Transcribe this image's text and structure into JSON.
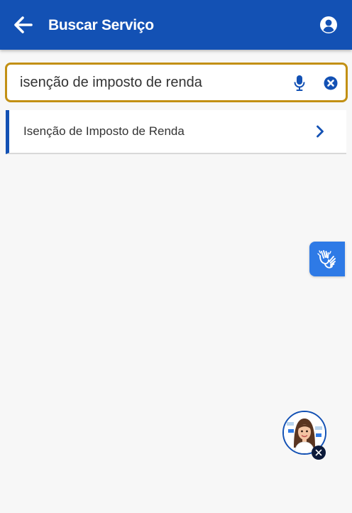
{
  "header": {
    "title": "Buscar Serviço",
    "back_icon": "arrow-left-icon",
    "account_icon": "user-circle-icon",
    "background_color": "#1351b4"
  },
  "search": {
    "value": "isenção de imposto de renda",
    "mic_icon": "microphone-icon",
    "clear_icon": "close-circle-icon",
    "border_color": "#c29014"
  },
  "results": [
    {
      "label": "Isenção de Imposto de Renda",
      "icon": "chevron-right-icon"
    }
  ],
  "accessibility": {
    "vlibras_icon": "sign-language-hands-icon",
    "vlibras_color": "#2e7ae6"
  },
  "assistant": {
    "avatar_icon": "assistant-avatar-icon",
    "close_icon": "close-icon"
  }
}
